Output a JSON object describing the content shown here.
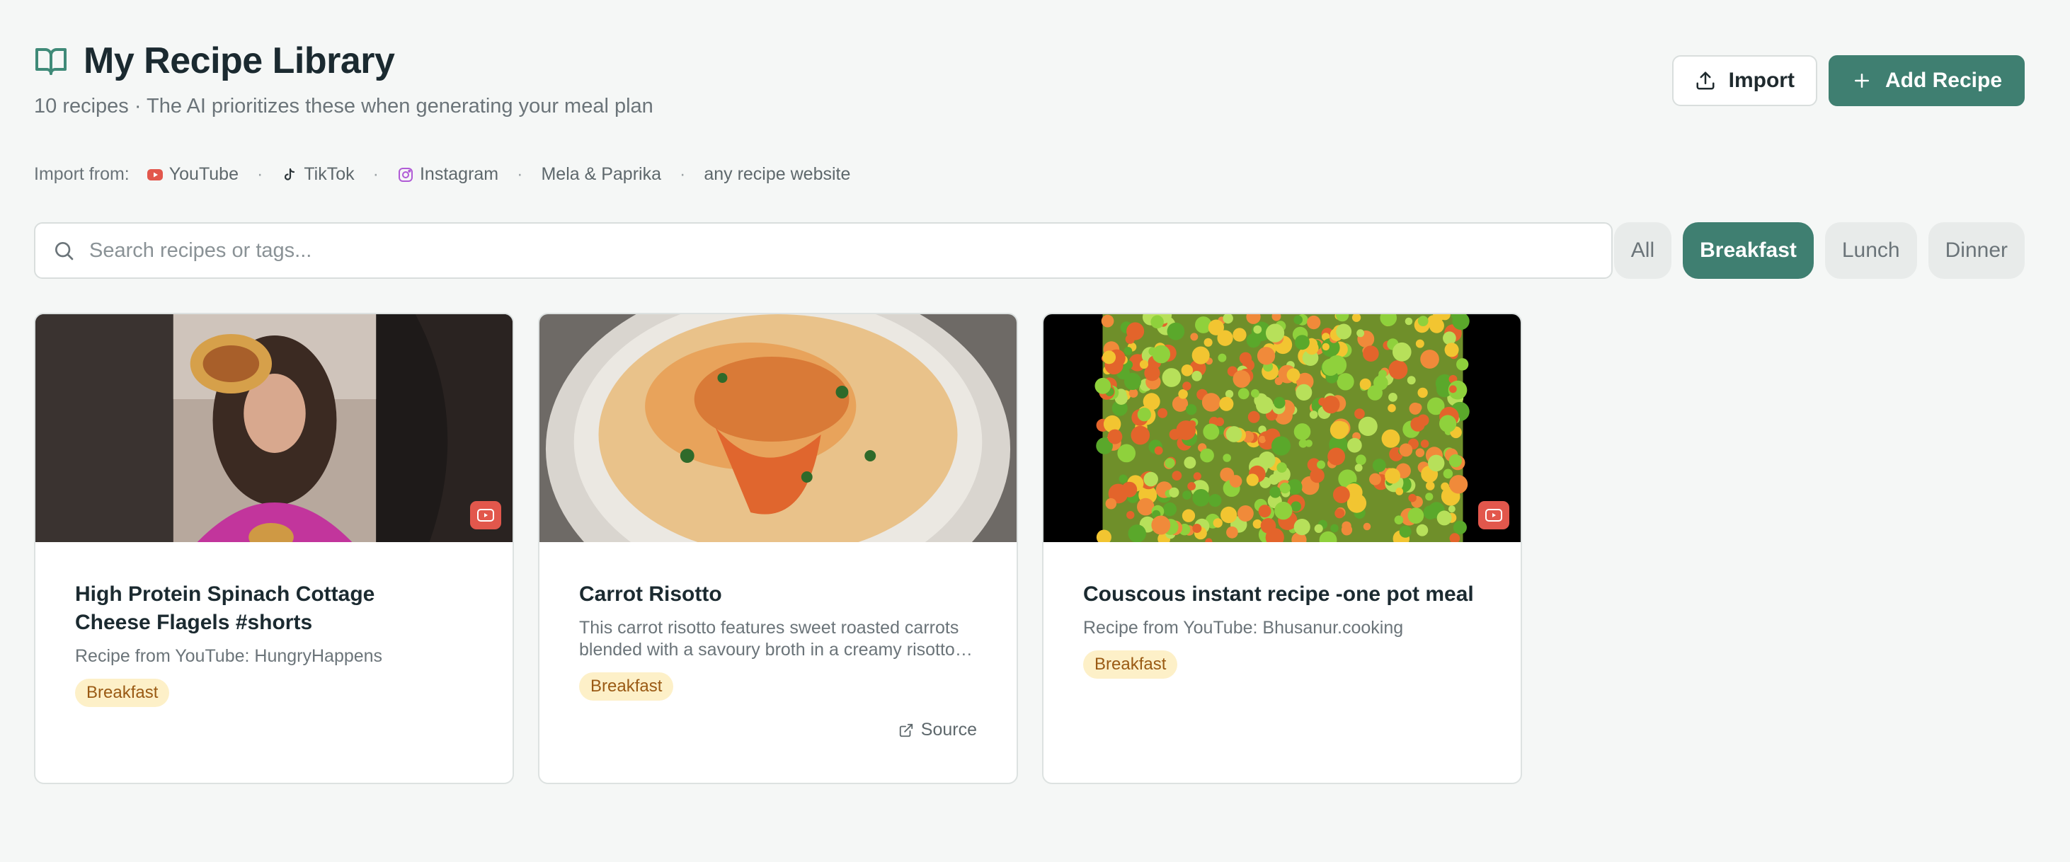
{
  "header": {
    "title": "My Recipe Library",
    "subtitle": "10 recipes · The AI prioritizes these when generating your meal plan",
    "import_label": "Import",
    "add_label": "Add Recipe"
  },
  "sources": {
    "label": "Import from:",
    "items": [
      "YouTube",
      "TikTok",
      "Instagram",
      "Mela & Paprika",
      "any recipe website"
    ],
    "separator": "·"
  },
  "search": {
    "placeholder": "Search recipes or tags..."
  },
  "filters": [
    {
      "label": "All",
      "active": false
    },
    {
      "label": "Breakfast",
      "active": true
    },
    {
      "label": "Lunch",
      "active": false
    },
    {
      "label": "Dinner",
      "active": false
    }
  ],
  "recipes": [
    {
      "title": "High Protein Spinach Cottage Cheese Flagels #shorts",
      "description": "Recipe from YouTube: HungryHappens",
      "tag": "Breakfast",
      "video": true
    },
    {
      "title": "Carrot Risotto",
      "description": "This carrot risotto features sweet roasted carrots blended with a savoury broth in a creamy risotto texture.",
      "tag": "Breakfast",
      "source_label": "Source"
    },
    {
      "title": "Couscous instant recipe -one pot meal",
      "description": "Recipe from YouTube: Bhusanur.cooking",
      "tag": "Breakfast",
      "video": true
    }
  ],
  "colors": {
    "accent": "#3f7f71",
    "tag_bg": "#fdf0c8",
    "tag_text": "#9a5a14",
    "youtube": "#e2574c"
  }
}
